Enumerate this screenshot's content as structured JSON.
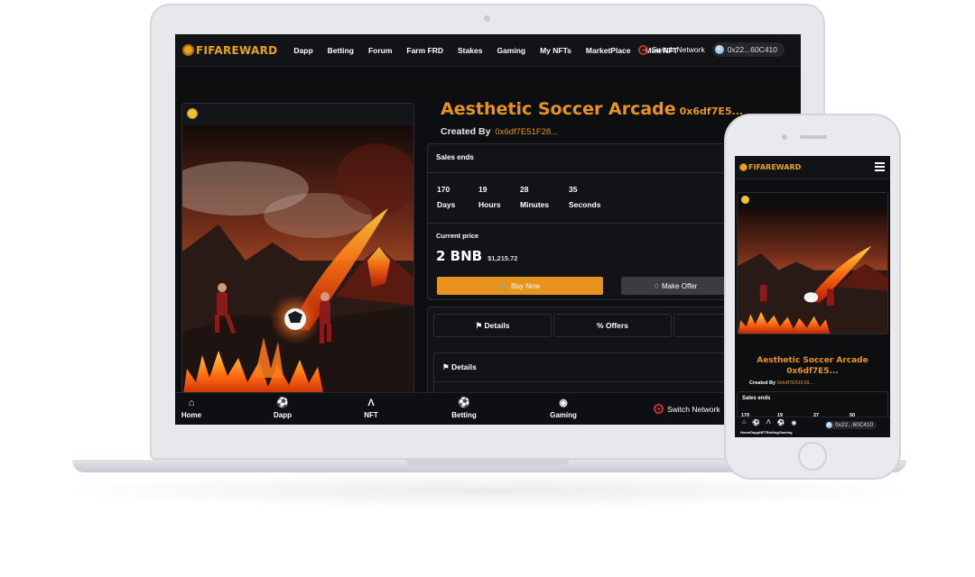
{
  "desktop": {
    "logo_text": "FIFAREWARD",
    "nav_links": [
      "Dapp",
      "Betting",
      "Forum",
      "Farm FRD",
      "Stakes",
      "Gaming",
      "My NFTs",
      "MarketPlace",
      "Mint NFT"
    ],
    "switch_network_label": "Switch Network",
    "wallet_address": "0x22...60C410",
    "nft_title": "Aesthetic Soccer Arcade",
    "nft_title_address": "0x6df7E5...",
    "created_by_label": "Created By",
    "creator_address": "0x6df7E51F28...",
    "sales_ends_label": "Sales ends",
    "countdown": [
      {
        "value": "170",
        "unit": "Days"
      },
      {
        "value": "19",
        "unit": "Hours"
      },
      {
        "value": "28",
        "unit": "Minutes"
      },
      {
        "value": "35",
        "unit": "Seconds"
      }
    ],
    "current_price_label": "Current price",
    "price": "2 BNB",
    "price_usd": "$1,215.72",
    "buy_now_label": "Buy Now",
    "make_offer_label": "Make Offer",
    "tabs": [
      "Details",
      "Offers",
      ""
    ],
    "details_heading": "Details",
    "bottom_nav": [
      "Home",
      "Dapp",
      "NFT",
      "Betting",
      "Gaming"
    ],
    "accent_color": "#e8931e"
  },
  "mobile": {
    "logo_text": "FIFAREWARD",
    "nft_title": "Aesthetic Soccer Arcade",
    "nft_title_address": "0x6df7E5...",
    "created_by_label": "Created By",
    "creator_address": "0x6df7E51F28...",
    "sales_ends_label": "Sales ends",
    "countdown_values": [
      "170",
      "19",
      "27",
      "50"
    ],
    "bottom_labels": "HomeDappNFTBettingGaming",
    "wallet_address": "0x22...60C410"
  }
}
